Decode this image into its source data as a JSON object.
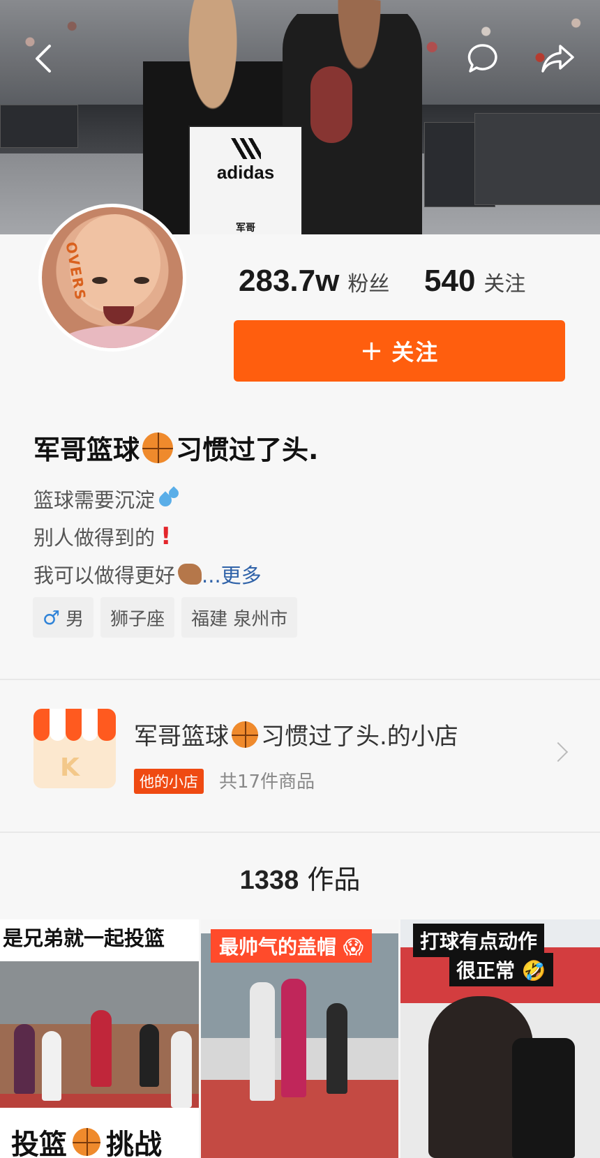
{
  "cover": {
    "certificate_brand": "adidas",
    "certificate_name": "军哥"
  },
  "profile": {
    "fans_count": "283.7w",
    "fans_label": "粉丝",
    "following_count": "540",
    "following_label": "关注",
    "follow_button_label": "关注",
    "nickname_part1": "军哥篮球",
    "nickname_part2": "习惯过了头.",
    "bio_line1": "篮球需要沉淀",
    "bio_line2": "别人做得到的",
    "bio_line3": "我可以做得更好",
    "bio_more": "...更多",
    "tags": {
      "gender": "男",
      "zodiac": "狮子座",
      "location": "福建 泉州市"
    }
  },
  "shop": {
    "title_part1": "军哥篮球",
    "title_part2": "习惯过了头.的小店",
    "badge": "他的小店",
    "count": "共17件商品"
  },
  "works": {
    "count": "1338",
    "label": "作品"
  },
  "videos": [
    {
      "caption_top": "是兄弟就一起投篮",
      "caption_bottom": "投篮",
      "caption_bottom2": "挑战"
    },
    {
      "caption_top": "最帅气的盖帽"
    },
    {
      "caption_top": "打球有点动作",
      "caption_top2": "很正常"
    }
  ],
  "colors": {
    "accent": "#ff5e0e",
    "shop_badge": "#ef4a12",
    "more_link": "#2f62a8",
    "gender_icon": "#2f83d8"
  },
  "icons": [
    "back-icon",
    "comment-icon",
    "share-icon",
    "plus-icon",
    "basketball-emoji",
    "gender-male-icon",
    "chevron-right-icon"
  ]
}
